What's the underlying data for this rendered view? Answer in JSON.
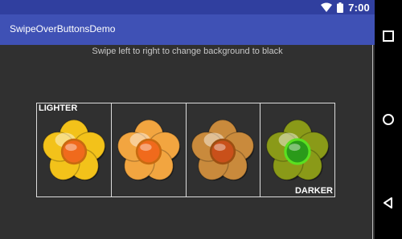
{
  "status": {
    "time": "7:00"
  },
  "app": {
    "title": "SwipeOverButtonsDemo"
  },
  "content": {
    "instruction": "Swipe left to right to change background to black",
    "label_lighter": "LIGHTER",
    "label_darker": "DARKER"
  },
  "buttons": [
    {
      "petal": "#f3c21a",
      "center": "#f06a1c",
      "ring": "#c86a10"
    },
    {
      "petal": "#f2a540",
      "center": "#f06a1c",
      "ring": "#c86a10"
    },
    {
      "petal": "#c98a3c",
      "center": "#c9501a",
      "ring": "#9c4f12"
    },
    {
      "petal": "#8a9a18",
      "center": "#2a9a1a",
      "ring": "#5ae020",
      "selected": true
    }
  ],
  "icons": {
    "wifi": "wifi-icon",
    "battery": "battery-icon",
    "recents": "recents-icon",
    "home": "home-icon",
    "back": "back-icon"
  }
}
